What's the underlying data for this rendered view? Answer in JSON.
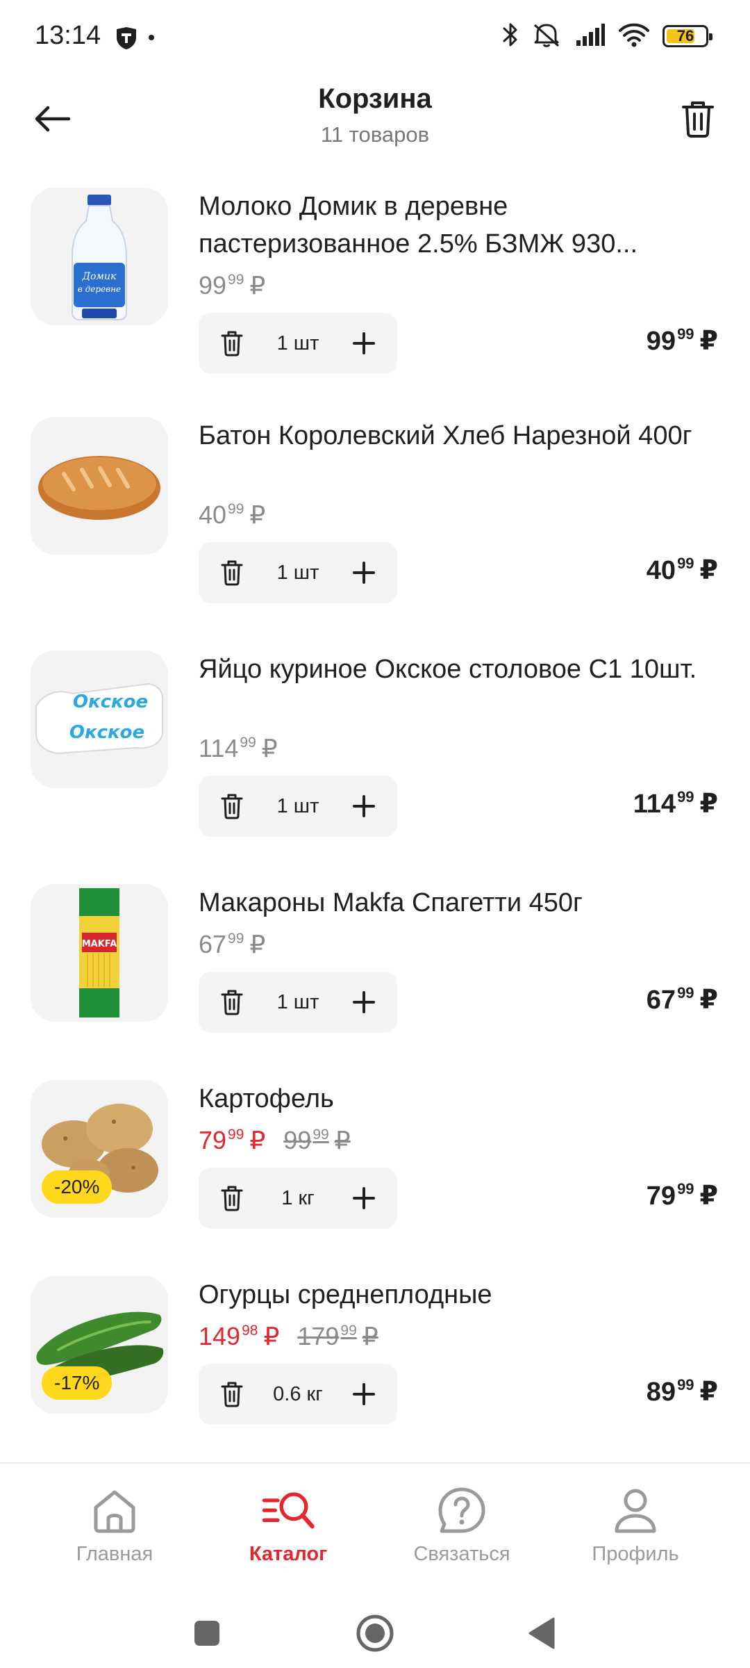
{
  "status_bar": {
    "time": "13:14",
    "battery_percent": "76",
    "battery_level": 0.76,
    "icons": [
      "shield-app-icon",
      "bluetooth-icon",
      "mute-icon",
      "signal-icon",
      "wifi-icon",
      "battery-icon"
    ]
  },
  "header": {
    "title": "Корзина",
    "subtitle": "11 товаров",
    "back_icon": "arrow-left-icon",
    "clear_icon": "trash-icon"
  },
  "colors": {
    "accent": "#e3272d",
    "discount_badge": "#ffd81c",
    "thumb_bg": "#f3f3f3",
    "stepper_bg": "#f4f4f4",
    "muted_text": "#8a8a8a"
  },
  "cart": {
    "items": [
      {
        "name": "Молоко Домик в деревне пастеризованное 2.5% БЗМЖ 930...",
        "price_int": "99",
        "price_frac": "99",
        "currency": "₽",
        "qty": "1 шт",
        "total_int": "99",
        "total_frac": "99",
        "image": "milk-bottle-image"
      },
      {
        "name": "Батон Королевский Хлеб Нарезной 400г",
        "price_int": "40",
        "price_frac": "99",
        "currency": "₽",
        "qty": "1 шт",
        "total_int": "40",
        "total_frac": "99",
        "image": "bread-loaf-image"
      },
      {
        "name": "Яйцо куриное Окское столовое С1 10шт.",
        "price_int": "114",
        "price_frac": "99",
        "currency": "₽",
        "qty": "1 шт",
        "total_int": "114",
        "total_frac": "99",
        "image": "egg-carton-image"
      },
      {
        "name": "Макароны Makfa Спагетти 450г",
        "price_int": "67",
        "price_frac": "99",
        "currency": "₽",
        "qty": "1 шт",
        "total_int": "67",
        "total_frac": "99",
        "image": "spaghetti-pack-image"
      },
      {
        "name": "Картофель",
        "price_int": "79",
        "price_frac": "99",
        "currency": "₽",
        "old_price_int": "99",
        "old_price_frac": "99",
        "discount": "-20%",
        "qty": "1 кг",
        "total_int": "79",
        "total_frac": "99",
        "image": "potatoes-image"
      },
      {
        "name": "Огурцы среднеплодные",
        "price_int": "149",
        "price_frac": "98",
        "currency": "₽",
        "old_price_int": "179",
        "old_price_frac": "99",
        "discount": "-17%",
        "qty": "0.6 кг",
        "total_int": "89",
        "total_frac": "99",
        "image": "cucumbers-image"
      }
    ]
  },
  "bottom_nav": {
    "items": [
      {
        "label": "Главная",
        "icon": "home-icon",
        "active": false
      },
      {
        "label": "Каталог",
        "icon": "catalog-search-icon",
        "active": true
      },
      {
        "label": "Связаться",
        "icon": "help-chat-icon",
        "active": false
      },
      {
        "label": "Профиль",
        "icon": "profile-icon",
        "active": false
      }
    ]
  },
  "system_nav": {
    "items": [
      "recents-square-icon",
      "home-circle-icon",
      "back-triangle-icon"
    ]
  }
}
